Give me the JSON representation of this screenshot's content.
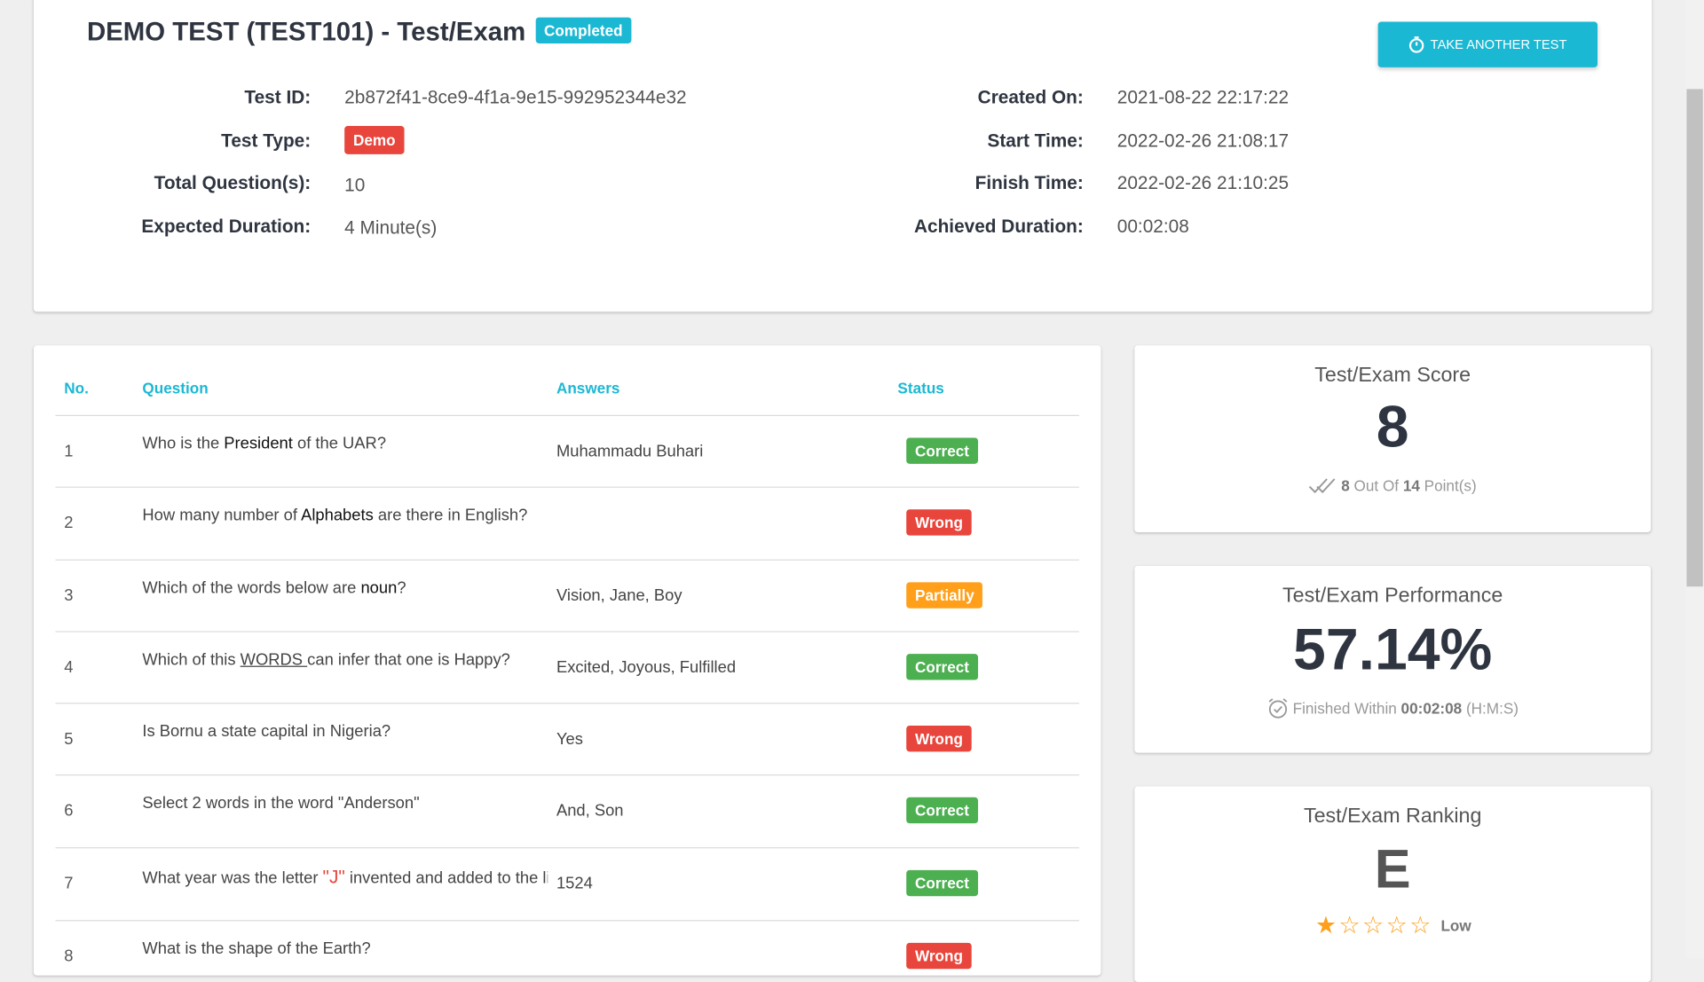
{
  "header": {
    "title": "DEMO TEST (TEST101) - Test/Exam",
    "status_badge": "Completed",
    "take_another_label": "TAKE ANOTHER TEST",
    "left_info": [
      {
        "label": "Test ID:",
        "value": "2b872f41-8ce9-4f1a-9e15-992952344e32"
      },
      {
        "label": "Test Type:",
        "value": "Demo"
      },
      {
        "label": "Total Question(s):",
        "value": "10"
      },
      {
        "label": "Expected Duration:",
        "value": "4 Minute(s)"
      }
    ],
    "right_info": [
      {
        "label": "Created On:",
        "value": "2021-08-22 22:17:22"
      },
      {
        "label": "Start Time:",
        "value": "2022-02-26 21:08:17"
      },
      {
        "label": "Finish Time:",
        "value": "2022-02-26 21:10:25"
      },
      {
        "label": "Achieved Duration:",
        "value": "00:02:08"
      }
    ]
  },
  "table": {
    "headers": {
      "no": "No.",
      "question": "Question",
      "answers": "Answers",
      "status": "Status"
    },
    "rows": [
      {
        "no": "1",
        "q_pre": "Who is the ",
        "q_bold": "President",
        "q_post": " of the UAR?",
        "answer": "Muhammadu Buhari",
        "status": "Correct"
      },
      {
        "no": "2",
        "q_pre": "How many number of ",
        "q_bold": "Alphabets",
        "q_post": " are there in English?",
        "answer": "",
        "status": "Wrong"
      },
      {
        "no": "3",
        "q_pre": "Which of the words below are ",
        "q_bold": "noun",
        "q_post": "?",
        "answer": "Vision, Jane, Boy",
        "status": "Partially"
      },
      {
        "no": "4",
        "q_pre": "Which of this ",
        "q_under": "WORDS ",
        "q_post": "can infer that one is Happy?",
        "answer": "Excited, Joyous, Fulfilled",
        "status": "Correct"
      },
      {
        "no": "5",
        "q_pre": "Is Bornu a state capital in Nigeria?",
        "answer": "Yes",
        "status": "Wrong"
      },
      {
        "no": "6",
        "q_pre": "Select 2 words in the word \"Anderson\"",
        "answer": "And, Son",
        "status": "Correct"
      },
      {
        "no": "7",
        "q_pre": "What year was the letter ",
        "q_red": "\"J\"",
        "q_post": " invented and added to the list o",
        "answer": "1524",
        "status": "Correct"
      },
      {
        "no": "8",
        "q_pre": "What is the shape of the Earth?",
        "answer": "",
        "status": "Wrong"
      }
    ]
  },
  "score": {
    "title": "Test/Exam Score",
    "value": "8",
    "obtained": "8",
    "out_of_text": " Out Of ",
    "total": "14",
    "points_text": " Point(s)"
  },
  "performance": {
    "title": "Test/Exam Performance",
    "value": "57.14%",
    "finished_text": "Finished Within ",
    "duration": "00:02:08",
    "unit_text": " (H:M:S)"
  },
  "ranking": {
    "title": "Test/Exam Ranking",
    "grade": "E",
    "stars_filled": 1,
    "stars_total": 5,
    "level": "Low"
  },
  "colors": {
    "accent": "#1bb8d3",
    "correct": "#4caf50",
    "wrong": "#e8453c",
    "partially": "#ff9f1a",
    "star": "#ff9f1a"
  }
}
